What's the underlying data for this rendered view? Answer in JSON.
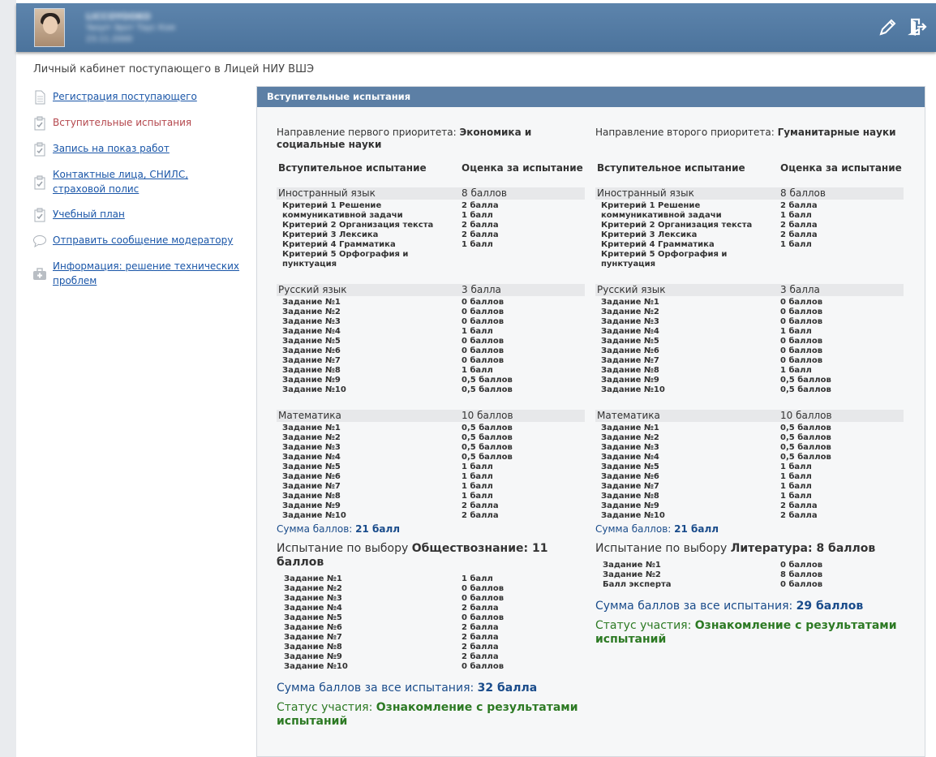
{
  "header": {
    "user_name": "LICCOYOOKO",
    "user_line2": "Yaoyrr Эрот Таус Кхм",
    "user_date": "23.11.2000"
  },
  "page_subtitle": "Личный кабинет поступающего в Лицей НИУ ВШЭ",
  "sidebar": {
    "items": [
      {
        "label": "Регистрация поступающего",
        "icon": "document-icon",
        "active": false
      },
      {
        "label": "Вступительные испытания",
        "icon": "clipboard-check-icon",
        "active": true
      },
      {
        "label": "Запись на показ работ",
        "icon": "clipboard-check-icon",
        "active": false
      },
      {
        "label": "Контактные лица, СНИЛС, страховой полис",
        "icon": "clipboard-check-icon",
        "active": false
      },
      {
        "label": "Учебный план",
        "icon": "clipboard-check-icon",
        "active": false
      },
      {
        "label": "Отправить сообщение модератору",
        "icon": "speech-bubble-icon",
        "active": false
      },
      {
        "label": "Информация: решение технических проблем",
        "icon": "first-aid-kit-icon",
        "active": false
      }
    ]
  },
  "main": {
    "title": "Вступительные испытания",
    "col_header_test": "Вступительное испытание",
    "col_header_score": "Оценка за испытание",
    "sum_label": "Сумма баллов: ",
    "elective_label": "Испытание по выбору ",
    "total_label": "Сумма баллов за все испытания: ",
    "status_label": "Статус участия: ",
    "columns": [
      {
        "priority_label": "Направление первого приоритета: ",
        "priority_value": "Экономика и социальные науки",
        "subjects": [
          {
            "name": "Иностранный язык",
            "score": "8 баллов",
            "rows": [
              [
                "Критерий 1 Решение коммуникативной задачи",
                "2 балла\n1 балл"
              ],
              [
                "Критерий 2 Организация текста",
                "2 балла"
              ],
              [
                "Критерий 3 Лексика",
                "2 балла"
              ],
              [
                "Критерий 4 Грамматика",
                "1 балл"
              ],
              [
                "Критерий 5 Орфография и пунктуация",
                ""
              ]
            ]
          },
          {
            "name": "Русский язык",
            "score": "3 балла",
            "rows": [
              [
                "Задание №1",
                "0 баллов"
              ],
              [
                "Задание №2",
                "0 баллов"
              ],
              [
                "Задание №3",
                "0 баллов"
              ],
              [
                "Задание №4",
                "1 балл"
              ],
              [
                "Задание №5",
                "0 баллов"
              ],
              [
                "Задание №6",
                "0 баллов"
              ],
              [
                "Задание №7",
                "0 баллов"
              ],
              [
                "Задание №8",
                "1 балл"
              ],
              [
                "Задание №9",
                "0,5 баллов"
              ],
              [
                "Задание №10",
                "0,5 баллов"
              ]
            ]
          },
          {
            "name": "Математика",
            "score": "10 баллов",
            "rows": [
              [
                "Задание №1",
                "0,5 баллов"
              ],
              [
                "Задание №2",
                "0,5 баллов"
              ],
              [
                "Задание №3",
                "0,5 баллов"
              ],
              [
                "Задание №4",
                "0,5 баллов"
              ],
              [
                "Задание №5",
                "1 балл"
              ],
              [
                "Задание №6",
                "1 балл"
              ],
              [
                "Задание №7",
                "1 балл"
              ],
              [
                "Задание №8",
                "1 балл"
              ],
              [
                "Задание №9",
                "2 балла"
              ],
              [
                "Задание №10",
                "2 балла"
              ]
            ]
          }
        ],
        "sum_value": "21 балл",
        "elective_subject": "Обществознание",
        "elective_score": ": 11 баллов",
        "elective_rows": [
          [
            "Задание №1",
            "1 балл"
          ],
          [
            "Задание №2",
            "0 баллов"
          ],
          [
            "Задание №3",
            "0 баллов"
          ],
          [
            "Задание №4",
            "2 балла"
          ],
          [
            "Задание №5",
            "0 баллов"
          ],
          [
            "Задание №6",
            "2 балла"
          ],
          [
            "Задание №7",
            "2 балла"
          ],
          [
            "Задание №8",
            "2 балла"
          ],
          [
            "Задание №9",
            "2 балла"
          ],
          [
            "Задание №10",
            "0 баллов"
          ]
        ],
        "total_value": "32 балла",
        "status_value": "Ознакомление с результатами испытаний"
      },
      {
        "priority_label": "Направление второго приоритета: ",
        "priority_value": "Гуманитарные науки",
        "subjects": [
          {
            "name": "Иностранный язык",
            "score": "8 баллов",
            "rows": [
              [
                "Критерий 1 Решение коммуникативной задачи",
                "2 балла\n1 балл"
              ],
              [
                "Критерий 2 Организация текста",
                "2 балла"
              ],
              [
                "Критерий 3 Лексика",
                "2 балла"
              ],
              [
                "Критерий 4 Грамматика",
                "1 балл"
              ],
              [
                "Критерий 5 Орфография и пунктуация",
                ""
              ]
            ]
          },
          {
            "name": "Русский язык",
            "score": "3 балла",
            "rows": [
              [
                "Задание №1",
                "0 баллов"
              ],
              [
                "Задание №2",
                "0 баллов"
              ],
              [
                "Задание №3",
                "0 баллов"
              ],
              [
                "Задание №4",
                "1 балл"
              ],
              [
                "Задание №5",
                "0 баллов"
              ],
              [
                "Задание №6",
                "0 баллов"
              ],
              [
                "Задание №7",
                "0 баллов"
              ],
              [
                "Задание №8",
                "1 балл"
              ],
              [
                "Задание №9",
                "0,5 баллов"
              ],
              [
                "Задание №10",
                "0,5 баллов"
              ]
            ]
          },
          {
            "name": "Математика",
            "score": "10 баллов",
            "rows": [
              [
                "Задание №1",
                "0,5 баллов"
              ],
              [
                "Задание №2",
                "0,5 баллов"
              ],
              [
                "Задание №3",
                "0,5 баллов"
              ],
              [
                "Задание №4",
                "0,5 баллов"
              ],
              [
                "Задание №5",
                "1 балл"
              ],
              [
                "Задание №6",
                "1 балл"
              ],
              [
                "Задание №7",
                "1 балл"
              ],
              [
                "Задание №8",
                "1 балл"
              ],
              [
                "Задание №9",
                "2 балла"
              ],
              [
                "Задание №10",
                "2 балла"
              ]
            ]
          }
        ],
        "sum_value": "21 балл",
        "elective_subject": "Литература",
        "elective_score": ": 8 баллов",
        "elective_rows": [
          [
            "Задание №1",
            "0 баллов"
          ],
          [
            "Задание №2",
            "8 баллов"
          ],
          [
            "Балл эксперта",
            "0 баллов"
          ]
        ],
        "total_value": "29 баллов",
        "status_value": "Ознакомление с результатами испытаний"
      }
    ]
  },
  "colors": {
    "header_bg": "#4f77a0",
    "link": "#1a56a8",
    "active_link": "#b4474d",
    "sum_blue": "#1a4c8b",
    "status_green": "#2d7a24"
  }
}
